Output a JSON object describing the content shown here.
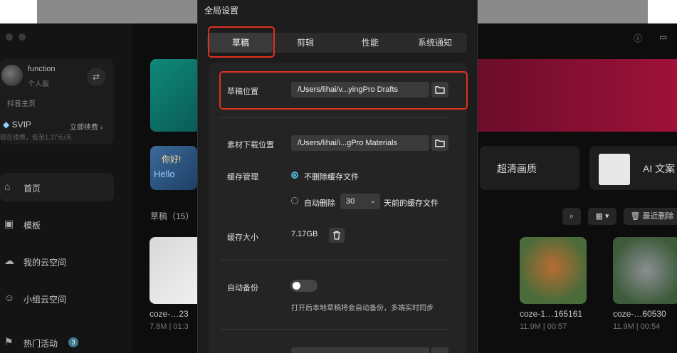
{
  "sidebar": {
    "username": "function",
    "user_type": "个人版",
    "homepage_link": "抖音主页",
    "svip": "SVIP",
    "renew": "立即续费",
    "svip_sub": "现在续费，低至1.37元/天",
    "nav": [
      {
        "label": "首页",
        "icon": "home-icon"
      },
      {
        "label": "模板",
        "icon": "template-icon"
      },
      {
        "label": "我的云空间",
        "icon": "cloud-icon"
      },
      {
        "label": "小组云空间",
        "icon": "team-icon"
      },
      {
        "label": "热门活动",
        "icon": "flag-icon",
        "badge": "3"
      }
    ]
  },
  "main": {
    "hello_text_1": "你好!",
    "hello_text_2": "Hello",
    "card_hd": "超清画质",
    "card_ai": "AI 文案",
    "drafts_title": "草稿（15）",
    "recent_delete": "最近删除",
    "drafts": [
      {
        "name": "coze-…23",
        "meta": "7.8M | 01:3"
      },
      {
        "name": "coze-1…165161",
        "meta": "11.9M | 00:57"
      },
      {
        "name": "coze-…60530",
        "meta": "11.9M | 00:54"
      }
    ]
  },
  "dialog": {
    "title": "全局设置",
    "tabs": [
      "草稿",
      "剪辑",
      "性能",
      "系统通知"
    ],
    "active_tab": "草稿",
    "draft_location_label": "草稿位置",
    "draft_location_value": "/Users/lihai/v...yingPro Drafts",
    "material_location_label": "素材下载位置",
    "material_location_value": "/Users/lihai/i...gPro Materials",
    "cache_mgmt_label": "缓存管理",
    "cache_option_keep": "不删除缓存文件",
    "cache_option_auto": "自动删除",
    "cache_days": "30",
    "cache_days_suffix": "天前的缓存文件",
    "cache_size_label": "缓存大小",
    "cache_size_value": "7.17GB",
    "auto_backup_label": "自动备份",
    "auto_backup_enabled": false,
    "auto_backup_hint": "打开后本地草稿将会自动备份，多端实时同步"
  },
  "colors": {
    "accent": "#4fb7d6",
    "highlight_red": "#e03020"
  }
}
